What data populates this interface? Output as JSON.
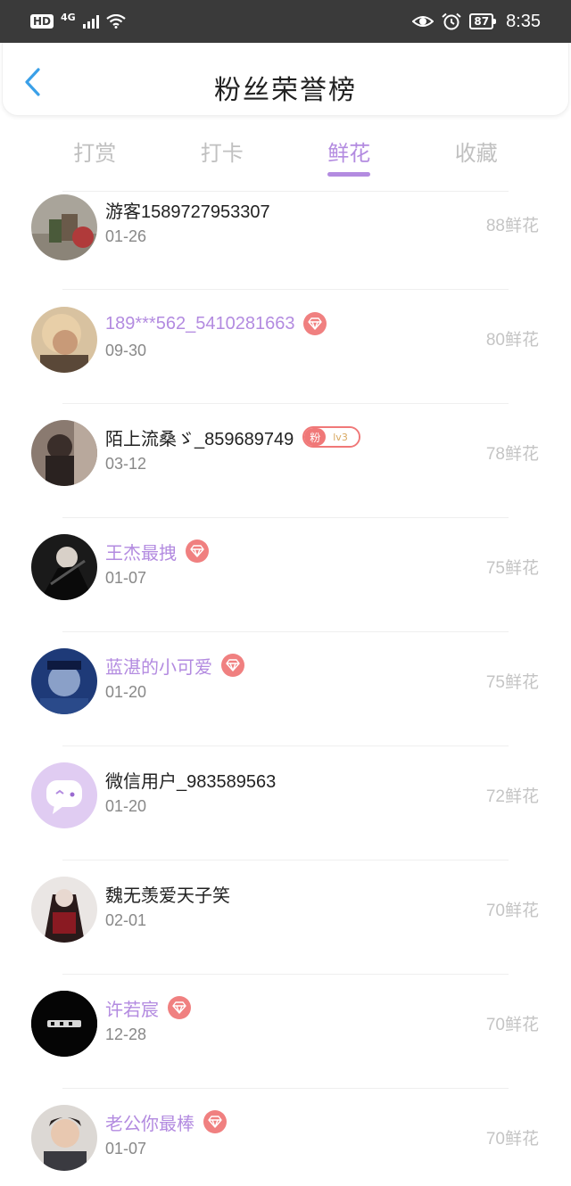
{
  "status_bar": {
    "hd": "HD",
    "network": "4G",
    "battery": "87",
    "time": "8:35"
  },
  "header": {
    "title": "粉丝荣誉榜",
    "back_icon": "chevron-left-icon"
  },
  "tabs": [
    {
      "label": "打赏",
      "active": false
    },
    {
      "label": "打卡",
      "active": false
    },
    {
      "label": "鲜花",
      "active": true
    },
    {
      "label": "收藏",
      "active": false
    }
  ],
  "colors": {
    "accent": "#b38be0",
    "badge": "#f08080",
    "amount": "#c4c4c4"
  },
  "fans": [
    {
      "name": "游客1589727953307",
      "date": "01-26",
      "amount": "88鲜花",
      "vip": false,
      "badge": "none"
    },
    {
      "name": "189***562_5410281663",
      "date": "09-30",
      "amount": "80鲜花",
      "vip": true,
      "badge": "gem"
    },
    {
      "name": "陌上流桑ゞ_859689749",
      "date": "03-12",
      "amount": "78鲜花",
      "vip": false,
      "badge": "fan",
      "fan_label": "粉",
      "fan_level": "lv3"
    },
    {
      "name": "王杰最拽",
      "date": "01-07",
      "amount": "75鲜花",
      "vip": true,
      "badge": "gem"
    },
    {
      "name": "蓝湛的小可爱",
      "date": "01-20",
      "amount": "75鲜花",
      "vip": true,
      "badge": "gem"
    },
    {
      "name": "微信用户_983589563",
      "date": "01-20",
      "amount": "72鲜花",
      "vip": false,
      "badge": "none"
    },
    {
      "name": "魏无羡爱天子笑",
      "date": "02-01",
      "amount": "70鲜花",
      "vip": false,
      "badge": "none"
    },
    {
      "name": "许若宸",
      "date": "12-28",
      "amount": "70鲜花",
      "vip": true,
      "badge": "gem"
    },
    {
      "name": "老公你最棒",
      "date": "01-07",
      "amount": "70鲜花",
      "vip": true,
      "badge": "gem"
    }
  ]
}
